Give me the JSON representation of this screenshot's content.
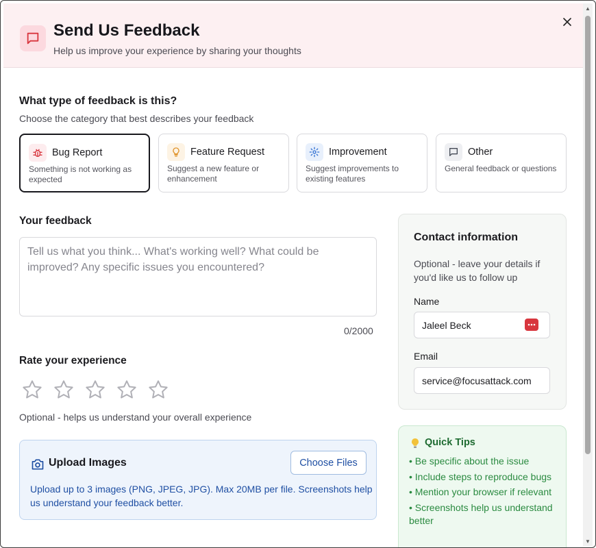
{
  "header": {
    "title": "Send Us Feedback",
    "subtitle": "Help us improve your experience by sharing your thoughts",
    "close_label": "×",
    "accent": "#d8363e",
    "background": "#fdf0f2"
  },
  "feedback_type": {
    "title": "What type of feedback is this?",
    "subtitle": "Choose the category that best describes your feedback",
    "selected": "Bug Report",
    "options": [
      {
        "label": "Bug Report",
        "description": "Something is not working as expected",
        "icon": "bug-icon",
        "color": "#d8363e"
      },
      {
        "label": "Feature Request",
        "description": "Suggest a new feature or enhancement",
        "icon": "lightbulb-icon",
        "color": "#e0932a"
      },
      {
        "label": "Improvement",
        "description": "Suggest improvements to existing features",
        "icon": "gear-icon",
        "color": "#2f6fd1"
      },
      {
        "label": "Other",
        "description": "General feedback or questions",
        "icon": "message-icon",
        "color": "#444a55"
      }
    ]
  },
  "feedback": {
    "title": "Your feedback",
    "placeholder": "Tell us what you think... What's working well? What could be improved? Any specific issues you encountered?",
    "value": "",
    "counter": "0/2000"
  },
  "rating": {
    "title": "Rate your experience",
    "value": 0,
    "max": 5,
    "note": "Optional - helps us understand your overall experience"
  },
  "upload": {
    "title": "Upload Images",
    "button_label": "Choose Files",
    "description": "Upload up to 3 images (PNG, JPEG, JPG). Max 20MB per file. Screenshots help us understand your feedback better.",
    "accent": "#1f4fa3"
  },
  "contact": {
    "title": "Contact information",
    "subtitle": "Optional - leave your details if you'd like us to follow up",
    "name_label": "Name",
    "name_value": "Jaleel Beck",
    "email_label": "Email",
    "email_value": "service@focusattack.com"
  },
  "tips": {
    "title": "Quick Tips",
    "items": [
      "• Be specific about the issue",
      "• Include steps to reproduce bugs",
      "• Mention your browser if relevant",
      "• Screenshots help us understand better"
    ],
    "accent": "#2a8a40"
  }
}
